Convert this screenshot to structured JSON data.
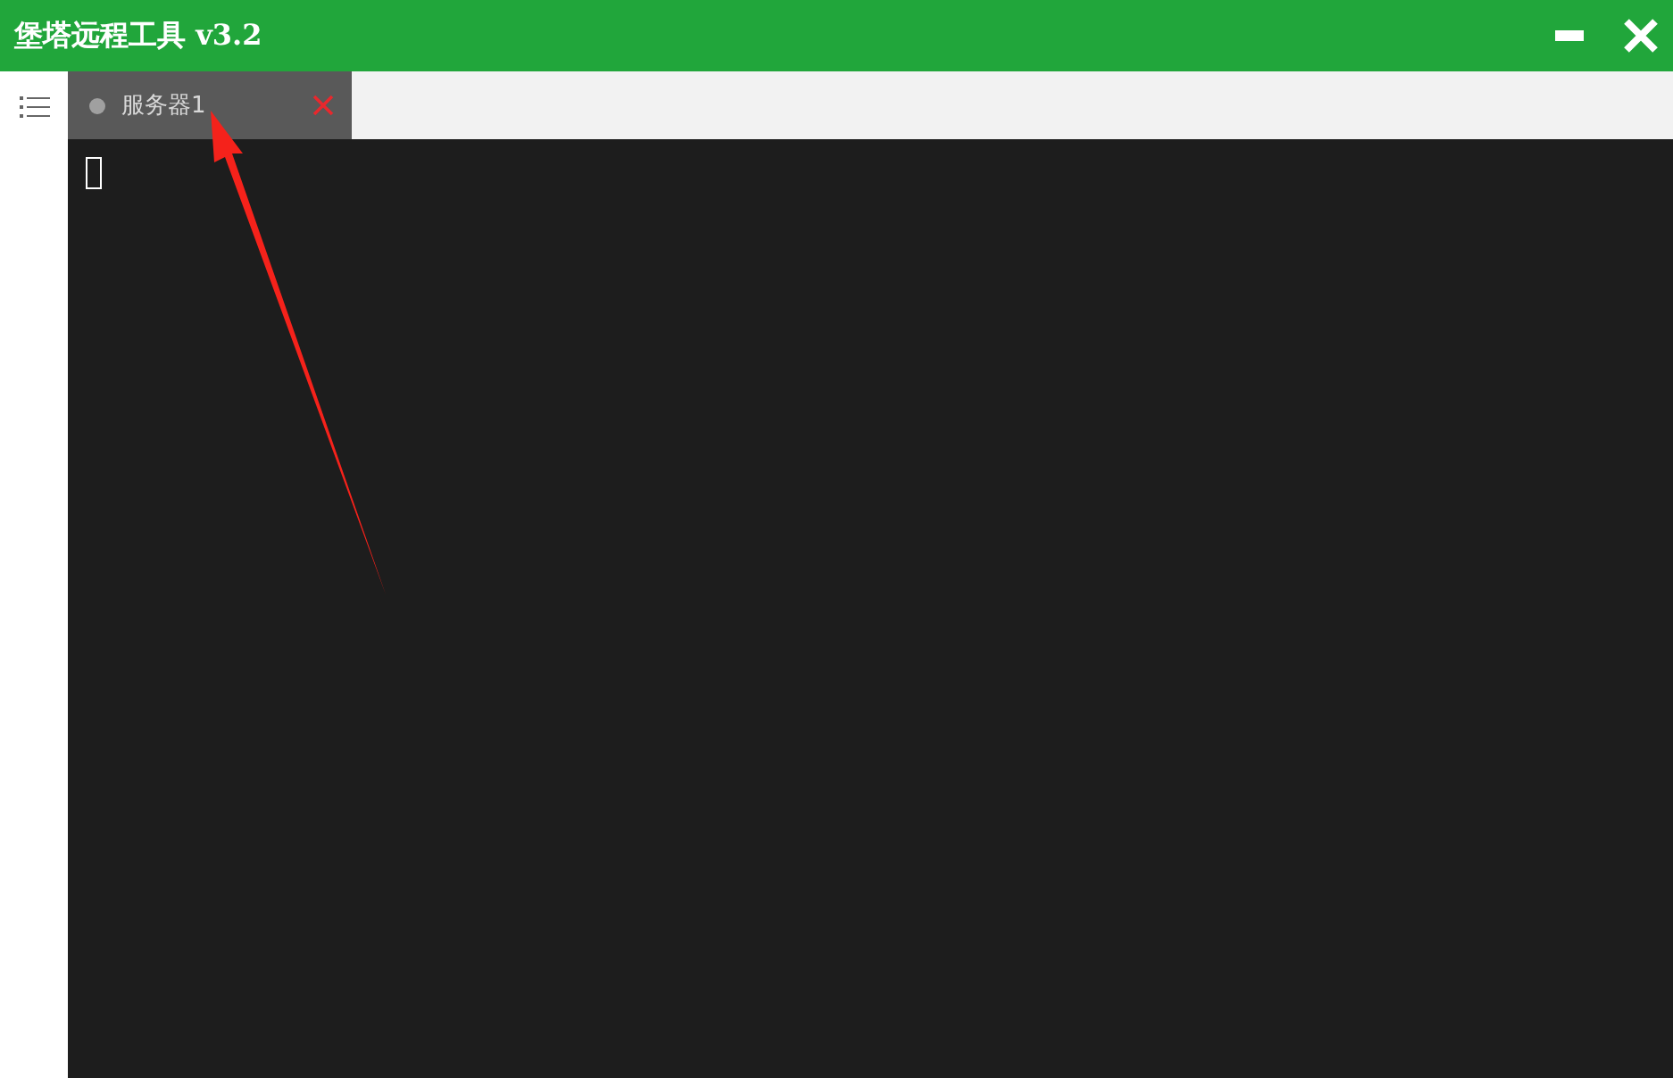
{
  "window": {
    "title": "堡塔远程工具 v3.2"
  },
  "tabs": [
    {
      "label": "服务器1",
      "selected": true
    }
  ],
  "terminal": {
    "cursor": true
  }
}
